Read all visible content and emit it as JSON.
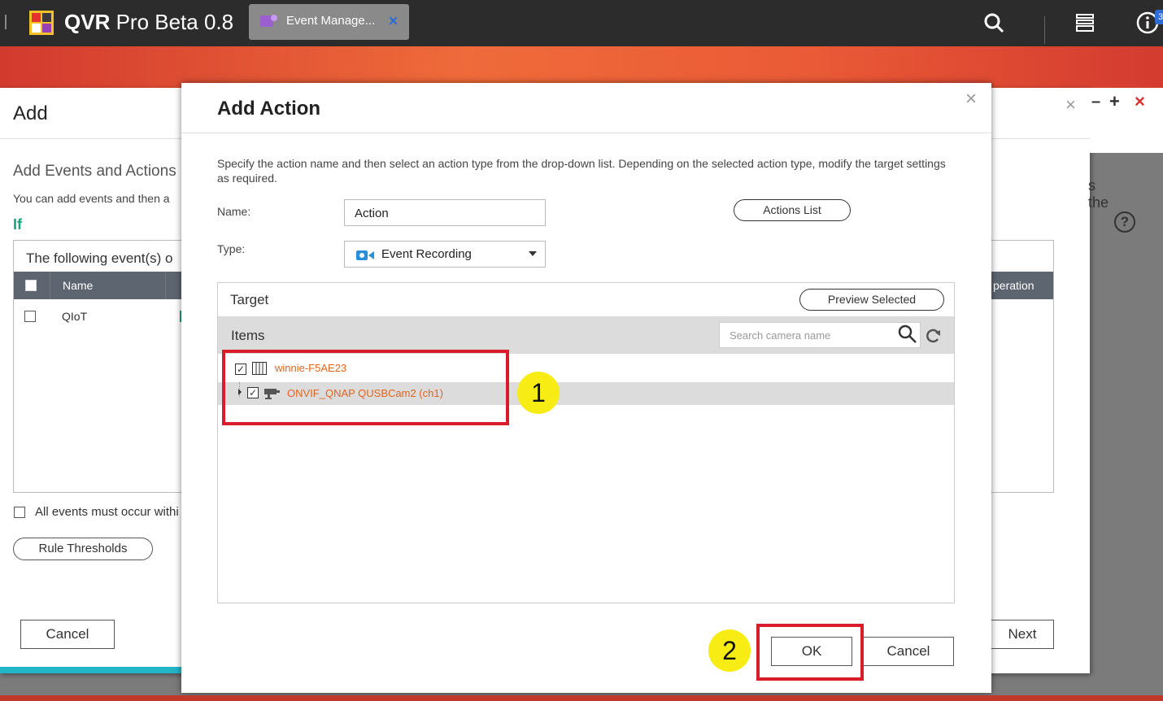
{
  "app": {
    "name_bold": "QVR",
    "name_rest": " Pro Beta 0.8",
    "tab_label": "Event Manage...",
    "tab_close": "×",
    "notification_count": "3"
  },
  "wizard": {
    "title": "Add",
    "close": "×",
    "section_title": "Add Events and Actions",
    "description": "You can add events and then a",
    "if_label": "If",
    "table_caption": "The following event(s) o",
    "col_name": "Name",
    "col_operation": "peration",
    "rows": [
      {
        "name": "QIoT"
      }
    ],
    "side_text": "s the",
    "all_events_label": "All events must occur withi",
    "rule_thresholds": "Rule Thresholds",
    "cancel": "Cancel",
    "next": "Next",
    "help": "?"
  },
  "window_controls": {
    "minimize": "–",
    "maximize": "+",
    "close": "×"
  },
  "modal": {
    "title": "Add Action",
    "close": "×",
    "description": "Specify the action name and then select an action type from the drop-down list. Depending on the selected action type, modify the target settings as required.",
    "name_label": "Name:",
    "name_value": "Action",
    "type_label": "Type:",
    "type_value": "Event Recording",
    "actions_list": "Actions List",
    "target_title": "Target",
    "preview_selected": "Preview Selected",
    "items_label": "Items",
    "search_placeholder": "Search camera name",
    "tree": [
      {
        "label": "winnie-F5AE23",
        "checked": true,
        "icon": "server-icon"
      },
      {
        "label": "ONVIF_QNAP QUSBCam2 (ch1)",
        "checked": true,
        "icon": "camera-icon"
      }
    ],
    "ok": "OK",
    "cancel": "Cancel"
  },
  "annotations": {
    "step1": "1",
    "step2": "2",
    "highlight_color": "#d91c2a",
    "badge_color": "#f7ec13"
  },
  "colors": {
    "accent_orange": "#e3651d",
    "teal": "#1aa37a",
    "banner": "#ea5a36"
  }
}
